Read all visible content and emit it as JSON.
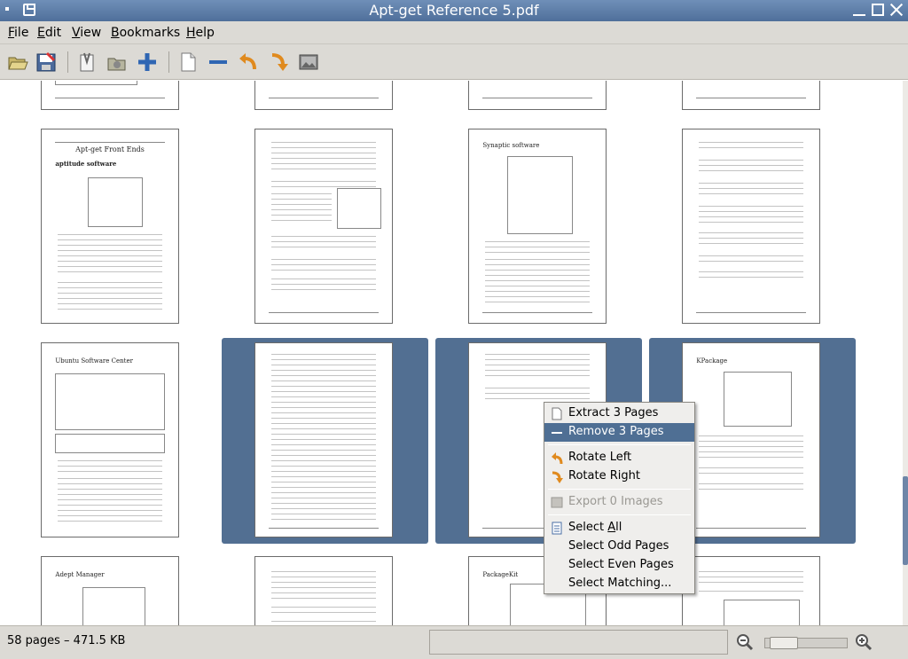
{
  "window": {
    "title": "Apt-get Reference 5.pdf"
  },
  "menubar": {
    "items": [
      {
        "pre": "",
        "key": "F",
        "post": "ile"
      },
      {
        "pre": "",
        "key": "E",
        "post": "dit"
      },
      {
        "pre": "",
        "key": "V",
        "post": "iew"
      },
      {
        "pre": "",
        "key": "B",
        "post": "ookmarks"
      },
      {
        "pre": "",
        "key": "H",
        "post": "elp"
      }
    ]
  },
  "toolbar": {
    "tools": [
      "open-icon",
      "save-icon",
      "properties-icon",
      "import-icon",
      "add-icon",
      "new-page-icon",
      "remove-icon",
      "rotate-left-icon",
      "rotate-right-icon",
      "export-images-icon"
    ]
  },
  "pages": {
    "row2": [
      {
        "title": "Apt-get Front Ends",
        "heading": "aptitude software"
      },
      {
        "title": ""
      },
      {
        "title": "Synaptic software"
      },
      {
        "title": ""
      }
    ],
    "row3": [
      {
        "title": "Ubuntu Software Center"
      },
      {
        "title": ""
      },
      {
        "title": ""
      },
      {
        "title": "KPackage"
      }
    ],
    "row4": [
      {
        "title": "Adept Manager"
      },
      {
        "title": ""
      },
      {
        "title": "PackageKit"
      },
      {
        "title": ""
      }
    ]
  },
  "context_menu": {
    "extract": "Extract 3 Pages",
    "remove": "Remove 3 Pages",
    "rotate_left": "Rotate Left",
    "rotate_right": "Rotate Right",
    "export": "Export 0 Images",
    "select_all_pre": "Select ",
    "select_all_key": "A",
    "select_all_post": "ll",
    "select_odd": "Select Odd Pages",
    "select_even": "Select Even Pages",
    "select_matching": "Select Matching..."
  },
  "statusbar": {
    "text": "58 pages – 471.5 KB",
    "zoom_level": 0.05
  },
  "colors": {
    "selection": "#526f92",
    "menu_highlight": "#4f6f94",
    "titlebar": "#5a7aa5"
  }
}
